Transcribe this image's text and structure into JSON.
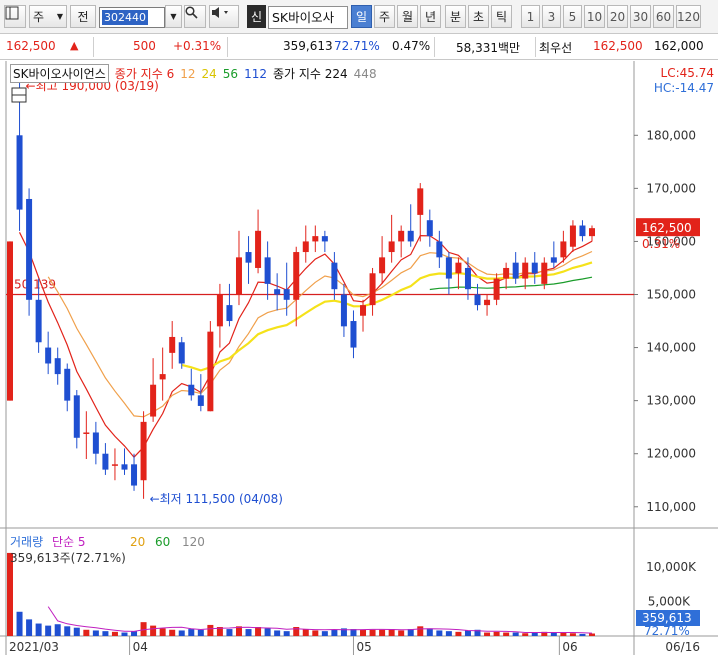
{
  "toolbar": {
    "market": "주",
    "period_btn": "전",
    "code": "302440",
    "name": "SK바이오사",
    "new_btn": "신",
    "periods": [
      "일",
      "주",
      "월",
      "년",
      "분",
      "초",
      "틱"
    ],
    "selected_period": "일",
    "intervals": [
      "1",
      "3",
      "5",
      "10",
      "20",
      "30",
      "60",
      "120"
    ]
  },
  "quote": {
    "price": "162,500",
    "change": "500",
    "change_pct": "+0.31%",
    "volume": "359,613",
    "vol_ratio": "72.71%",
    "turnover": "0.47%",
    "amount": "58,331백만",
    "best_label": "최우선",
    "best_ask": "162,500",
    "best_bid": "162,000"
  },
  "legend": {
    "name": "SK바이오사이언스",
    "ma_label": "종가 지수 6",
    "ma12": "12",
    "ma24": "24",
    "ma56": "56",
    "ma112": "112",
    "ma224_label": "종가 지수 224",
    "ma448": "448"
  },
  "annotations": {
    "lc": "LC:45.74",
    "hc": "HC:-14.47",
    "high": "최고 190,000 (03/19)",
    "low": "최저 111,500 (04/08)",
    "hline_label": "50.139",
    "last_price": "162,500",
    "last_pct": "0.31%"
  },
  "volume_panel": {
    "title": "거래량",
    "ma_label": "단순 5",
    "ma20": "20",
    "ma60": "60",
    "ma120": "120",
    "current": "359,613주(72.71%)",
    "axis_top": "10,000K",
    "axis_mid": "5,000K",
    "last_vol": "359,613",
    "last_pct": "72.71%"
  },
  "x_axis": [
    "2021/03",
    "04",
    "05",
    "06",
    "06/16"
  ],
  "colors": {
    "up": "#e2231a",
    "down": "#1f4fd1",
    "ma6": "#e2231a",
    "ma12": "#f0a04b",
    "ma24": "#f5e21a",
    "ma56": "#1a9c2a",
    "hline": "#d62020",
    "select": "#4a7fd2"
  },
  "chart_data": {
    "type": "candlestick",
    "y_ticks": [
      110000,
      120000,
      130000,
      140000,
      150000,
      160000,
      170000,
      180000
    ],
    "y_tick_labels": [
      "110,000",
      "120,000",
      "130,000",
      "140,000",
      "150,000",
      "160,000",
      "170,000",
      "180,000"
    ],
    "ylim": [
      106000,
      194000
    ],
    "hline_value": 150000,
    "volume_ylim": [
      0,
      13000000
    ],
    "candles": [
      {
        "o": 130000,
        "h": 160000,
        "l": 130000,
        "c": 160000,
        "v": 12000000
      },
      {
        "o": 180000,
        "h": 190000,
        "l": 162000,
        "c": 166000,
        "v": 3500000
      },
      {
        "o": 168000,
        "h": 170000,
        "l": 146000,
        "c": 149000,
        "v": 2400000
      },
      {
        "o": 149000,
        "h": 153000,
        "l": 139000,
        "c": 141000,
        "v": 1800000
      },
      {
        "o": 140000,
        "h": 143000,
        "l": 135000,
        "c": 137000,
        "v": 1500000
      },
      {
        "o": 138000,
        "h": 140000,
        "l": 133000,
        "c": 135000,
        "v": 1700000
      },
      {
        "o": 136000,
        "h": 137000,
        "l": 128000,
        "c": 130000,
        "v": 1400000
      },
      {
        "o": 131000,
        "h": 132000,
        "l": 121000,
        "c": 123000,
        "v": 1200000
      },
      {
        "o": 124000,
        "h": 128000,
        "l": 119000,
        "c": 124000,
        "v": 900000
      },
      {
        "o": 124000,
        "h": 126000,
        "l": 118000,
        "c": 120000,
        "v": 800000
      },
      {
        "o": 120000,
        "h": 122000,
        "l": 116000,
        "c": 117000,
        "v": 700000
      },
      {
        "o": 118000,
        "h": 121000,
        "l": 115000,
        "c": 118000,
        "v": 600000
      },
      {
        "o": 118000,
        "h": 121000,
        "l": 116000,
        "c": 117000,
        "v": 500000
      },
      {
        "o": 118000,
        "h": 120000,
        "l": 113000,
        "c": 114000,
        "v": 700000
      },
      {
        "o": 115000,
        "h": 128000,
        "l": 111500,
        "c": 126000,
        "v": 2000000
      },
      {
        "o": 127000,
        "h": 138000,
        "l": 126000,
        "c": 133000,
        "v": 1500000
      },
      {
        "o": 134000,
        "h": 140000,
        "l": 130000,
        "c": 135000,
        "v": 1100000
      },
      {
        "o": 139000,
        "h": 145000,
        "l": 136000,
        "c": 142000,
        "v": 900000
      },
      {
        "o": 141000,
        "h": 142000,
        "l": 136000,
        "c": 137000,
        "v": 800000
      },
      {
        "o": 133000,
        "h": 136000,
        "l": 130000,
        "c": 131000,
        "v": 1000000
      },
      {
        "o": 131000,
        "h": 135000,
        "l": 128000,
        "c": 129000,
        "v": 900000
      },
      {
        "o": 128000,
        "h": 145000,
        "l": 128000,
        "c": 143000,
        "v": 1600000
      },
      {
        "o": 144000,
        "h": 152000,
        "l": 140000,
        "c": 150000,
        "v": 1300000
      },
      {
        "o": 148000,
        "h": 152000,
        "l": 144000,
        "c": 145000,
        "v": 1000000
      },
      {
        "o": 150000,
        "h": 162000,
        "l": 148000,
        "c": 157000,
        "v": 1400000
      },
      {
        "o": 158000,
        "h": 161000,
        "l": 152000,
        "c": 156000,
        "v": 1000000
      },
      {
        "o": 155000,
        "h": 166000,
        "l": 154000,
        "c": 162000,
        "v": 1300000
      },
      {
        "o": 157000,
        "h": 160000,
        "l": 149000,
        "c": 152000,
        "v": 1100000
      },
      {
        "o": 151000,
        "h": 154000,
        "l": 147000,
        "c": 150000,
        "v": 800000
      },
      {
        "o": 151000,
        "h": 156000,
        "l": 146000,
        "c": 149000,
        "v": 700000
      },
      {
        "o": 149000,
        "h": 159000,
        "l": 144000,
        "c": 158000,
        "v": 1300000
      },
      {
        "o": 158000,
        "h": 163000,
        "l": 156000,
        "c": 160000,
        "v": 1000000
      },
      {
        "o": 160000,
        "h": 163000,
        "l": 158000,
        "c": 161000,
        "v": 800000
      },
      {
        "o": 161000,
        "h": 162000,
        "l": 158000,
        "c": 160000,
        "v": 700000
      },
      {
        "o": 156000,
        "h": 158000,
        "l": 149000,
        "c": 151000,
        "v": 900000
      },
      {
        "o": 150000,
        "h": 152000,
        "l": 142000,
        "c": 144000,
        "v": 1100000
      },
      {
        "o": 145000,
        "h": 147000,
        "l": 138000,
        "c": 140000,
        "v": 1000000
      },
      {
        "o": 146000,
        "h": 149000,
        "l": 143000,
        "c": 148000,
        "v": 900000
      },
      {
        "o": 148000,
        "h": 155000,
        "l": 146000,
        "c": 154000,
        "v": 900000
      },
      {
        "o": 154000,
        "h": 161000,
        "l": 152000,
        "c": 157000,
        "v": 900000
      },
      {
        "o": 158000,
        "h": 165000,
        "l": 156000,
        "c": 160000,
        "v": 1000000
      },
      {
        "o": 160000,
        "h": 163000,
        "l": 157000,
        "c": 162000,
        "v": 800000
      },
      {
        "o": 162000,
        "h": 167000,
        "l": 159000,
        "c": 160000,
        "v": 1000000
      },
      {
        "o": 165000,
        "h": 171000,
        "l": 160000,
        "c": 170000,
        "v": 1400000
      },
      {
        "o": 164000,
        "h": 166000,
        "l": 159000,
        "c": 161000,
        "v": 1100000
      },
      {
        "o": 160000,
        "h": 162000,
        "l": 155000,
        "c": 157000,
        "v": 800000
      },
      {
        "o": 157000,
        "h": 158000,
        "l": 150000,
        "c": 153000,
        "v": 700000
      },
      {
        "o": 154000,
        "h": 157000,
        "l": 151000,
        "c": 156000,
        "v": 600000
      },
      {
        "o": 155000,
        "h": 157000,
        "l": 149000,
        "c": 151000,
        "v": 800000
      },
      {
        "o": 150000,
        "h": 152000,
        "l": 147000,
        "c": 148000,
        "v": 900000
      },
      {
        "o": 148000,
        "h": 150000,
        "l": 146000,
        "c": 149000,
        "v": 500000
      },
      {
        "o": 149000,
        "h": 154000,
        "l": 148000,
        "c": 153000,
        "v": 600000
      },
      {
        "o": 153000,
        "h": 156000,
        "l": 151000,
        "c": 155000,
        "v": 500000
      },
      {
        "o": 156000,
        "h": 158000,
        "l": 152000,
        "c": 153000,
        "v": 500000
      },
      {
        "o": 153000,
        "h": 157000,
        "l": 151000,
        "c": 156000,
        "v": 400000
      },
      {
        "o": 156000,
        "h": 158000,
        "l": 152000,
        "c": 154000,
        "v": 500000
      },
      {
        "o": 152000,
        "h": 157000,
        "l": 151000,
        "c": 156000,
        "v": 600000
      },
      {
        "o": 157000,
        "h": 160000,
        "l": 155000,
        "c": 156000,
        "v": 500000
      },
      {
        "o": 157000,
        "h": 162000,
        "l": 156000,
        "c": 160000,
        "v": 500000
      },
      {
        "o": 159000,
        "h": 164000,
        "l": 158000,
        "c": 163000,
        "v": 400000
      },
      {
        "o": 163000,
        "h": 164000,
        "l": 160000,
        "c": 161000,
        "v": 300000
      },
      {
        "o": 161000,
        "h": 163000,
        "l": 160000,
        "c": 162500,
        "v": 359613
      }
    ]
  }
}
